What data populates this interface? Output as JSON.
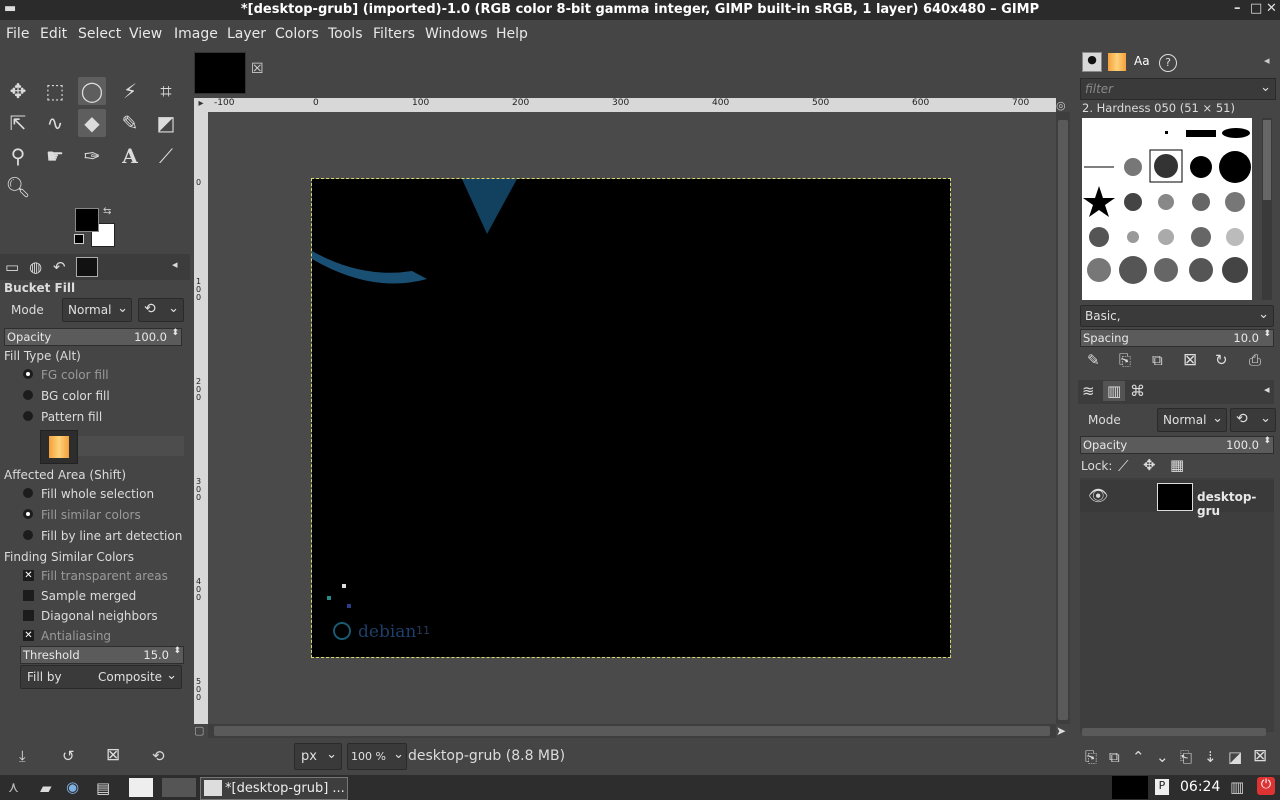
{
  "window": {
    "title": "*[desktop-grub] (imported)-1.0 (RGB color 8-bit gamma integer, GIMP built-in sRGB, 1 layer) 640x480 – GIMP",
    "minimize": "–",
    "maximize": "□",
    "close": "✕"
  },
  "menu": [
    "File",
    "Edit",
    "Select",
    "View",
    "Image",
    "Layer",
    "Colors",
    "Tools",
    "Filters",
    "Windows",
    "Help"
  ],
  "tab_close_icon": "☒",
  "tool_options": {
    "title": "Bucket Fill",
    "mode_label": "Mode",
    "mode_value": "Normal",
    "opacity_label": "Opacity",
    "opacity_value": "100.0",
    "fill_type_label": "Fill Type  (Alt)",
    "fill_types": [
      "FG color fill",
      "BG color fill",
      "Pattern fill"
    ],
    "affected_label": "Affected Area  (Shift)",
    "affected_options": [
      "Fill whole selection",
      "Fill similar colors",
      "Fill by line art detection"
    ],
    "finding_label": "Finding Similar Colors",
    "checks": [
      "Fill transparent areas",
      "Sample merged",
      "Diagonal neighbors",
      "Antialiasing"
    ],
    "threshold_label": "Threshold",
    "threshold_value": "15.0",
    "fillby_label": "Fill by",
    "fillby_value": "Composite"
  },
  "ruler": {
    "h_labels": [
      "-100",
      "0",
      "100",
      "200",
      "300",
      "400",
      "500",
      "600",
      "700"
    ],
    "v_labels": [
      "0",
      "1 0 0",
      "2 0 0",
      "3 0 0",
      "4 0 0",
      "5 0 0"
    ]
  },
  "image_overlay": {
    "logo_text": "debian",
    "version": "11"
  },
  "statusbar": {
    "unit": "px",
    "zoom": "100 %",
    "info": "desktop-grub (8.8 MB)"
  },
  "brushes": {
    "filter_placeholder": "filter",
    "selected_brush": "2. Hardness 050 (51 × 51)",
    "preset": "Basic,",
    "spacing_label": "Spacing",
    "spacing_value": "10.0"
  },
  "layers": {
    "mode_label": "Mode",
    "mode_value": "Normal",
    "opacity_label": "Opacity",
    "opacity_value": "100.0",
    "lock_label": "Lock:",
    "layer_name": "desktop-gru"
  },
  "taskbar": {
    "task_label": "*[desktop-grub] ...",
    "clock": "06:24"
  },
  "colors": {
    "fg": "#000000",
    "bg": "#ffffff",
    "accent_blue": "#1a4f74"
  }
}
